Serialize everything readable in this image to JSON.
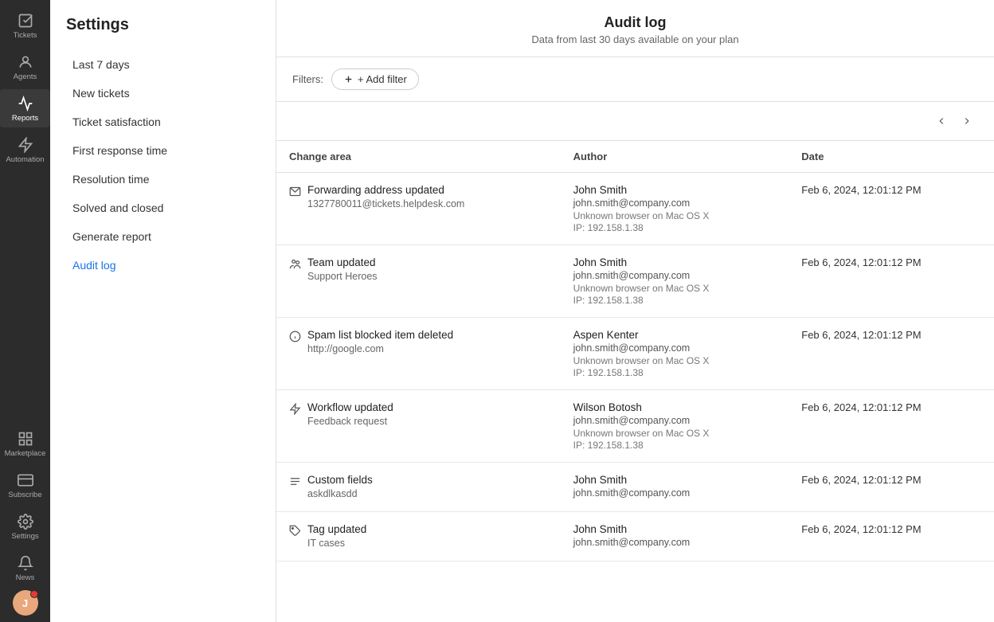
{
  "iconNav": {
    "items": [
      {
        "id": "tickets",
        "label": "Tickets",
        "icon": "check-square"
      },
      {
        "id": "agents",
        "label": "Agents",
        "icon": "users"
      },
      {
        "id": "reports",
        "label": "Reports",
        "icon": "bar-chart",
        "active": true
      },
      {
        "id": "automation",
        "label": "Automation",
        "icon": "lightning"
      }
    ],
    "bottomItems": [
      {
        "id": "marketplace",
        "label": "Marketplace",
        "icon": "grid"
      },
      {
        "id": "subscribe",
        "label": "Subscribe",
        "icon": "credit-card"
      },
      {
        "id": "settings",
        "label": "Settings",
        "icon": "gear"
      },
      {
        "id": "news",
        "label": "News",
        "icon": "bell"
      }
    ],
    "avatar": {
      "initials": "J",
      "hasBadge": true
    }
  },
  "sidebar": {
    "title": "Settings",
    "items": [
      {
        "id": "last7days",
        "label": "Last 7 days",
        "active": false
      },
      {
        "id": "newtickets",
        "label": "New tickets",
        "active": false
      },
      {
        "id": "ticketsatisfaction",
        "label": "Ticket satisfaction",
        "active": false
      },
      {
        "id": "firstresponsetime",
        "label": "First response time",
        "active": false
      },
      {
        "id": "resolutiontime",
        "label": "Resolution time",
        "active": false
      },
      {
        "id": "solvedandclosed",
        "label": "Solved and closed",
        "active": false
      },
      {
        "id": "generatereport",
        "label": "Generate report",
        "active": false
      },
      {
        "id": "auditlog",
        "label": "Audit log",
        "active": true
      }
    ]
  },
  "header": {
    "title": "Audit log",
    "subtitle": "Data from last 30 days available on your plan"
  },
  "filters": {
    "label": "Filters:",
    "addFilterLabel": "+ Add filter"
  },
  "table": {
    "columns": [
      "Change area",
      "Author",
      "Date"
    ],
    "rows": [
      {
        "icon": "envelope",
        "changeArea": "Forwarding address updated",
        "changeSub": "1327780011@tickets.helpdesk.com",
        "authorName": "John Smith",
        "authorEmail": "john.smith@company.com",
        "authorBrowser": "Unknown browser on Mac OS X",
        "authorIP": "IP: 192.158.1.38",
        "date": "Feb 6, 2024, 12:01:12 PM"
      },
      {
        "icon": "team",
        "changeArea": "Team updated",
        "changeSub": "Support Heroes",
        "authorName": "John Smith",
        "authorEmail": "john.smith@company.com",
        "authorBrowser": "Unknown browser on Mac OS X",
        "authorIP": "IP: 192.158.1.38",
        "date": "Feb 6, 2024, 12:01:12 PM"
      },
      {
        "icon": "info",
        "changeArea": "Spam list blocked item deleted",
        "changeSub": "http://google.com",
        "authorName": "Aspen Kenter",
        "authorEmail": "john.smith@company.com",
        "authorBrowser": "Unknown browser on Mac OS X",
        "authorIP": "IP: 192.158.1.38",
        "date": "Feb 6, 2024, 12:01:12 PM"
      },
      {
        "icon": "workflow",
        "changeArea": "Workflow updated",
        "changeSub": "Feedback request",
        "authorName": "Wilson Botosh",
        "authorEmail": "john.smith@company.com",
        "authorBrowser": "Unknown browser on Mac OS X",
        "authorIP": "IP: 192.158.1.38",
        "date": "Feb 6, 2024, 12:01:12 PM"
      },
      {
        "icon": "fields",
        "changeArea": "Custom fields",
        "changeSub": "askdlkasdd",
        "authorName": "John Smith",
        "authorEmail": "john.smith@company.com",
        "authorBrowser": "",
        "authorIP": "",
        "date": "Feb 6, 2024, 12:01:12 PM"
      },
      {
        "icon": "tag",
        "changeArea": "Tag updated",
        "changeSub": "IT cases",
        "authorName": "John Smith",
        "authorEmail": "john.smith@company.com",
        "authorBrowser": "",
        "authorIP": "",
        "date": "Feb 6, 2024, 12:01:12 PM"
      }
    ]
  }
}
